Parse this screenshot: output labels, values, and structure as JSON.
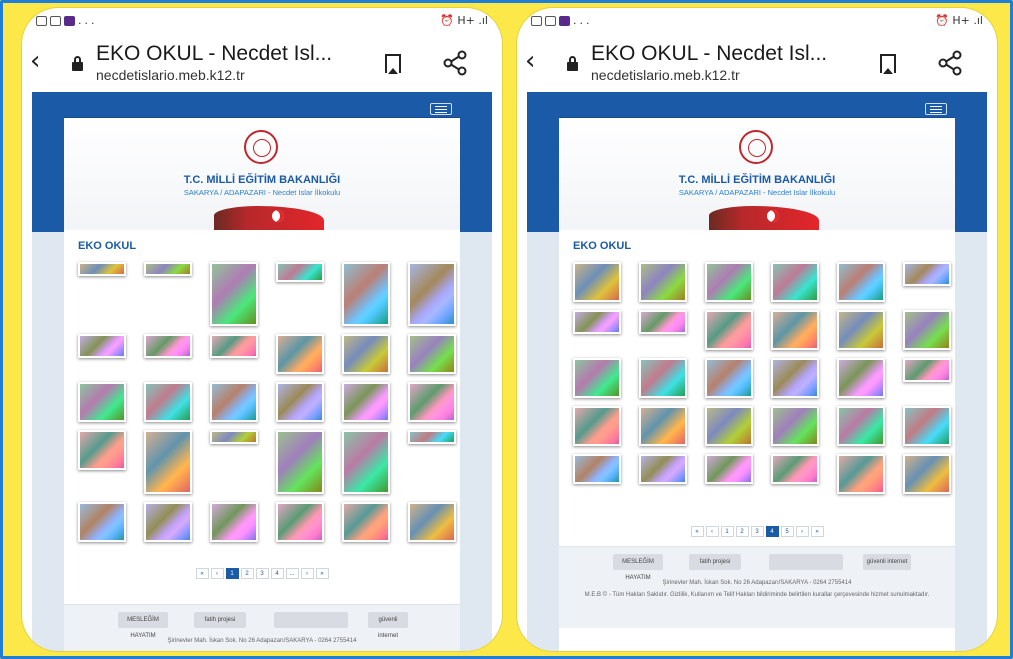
{
  "phones": [
    {
      "status_left": "...",
      "status_right": "⏰ H+ .ıl",
      "title": "EKO OKUL - Necdet Isl...",
      "url": "necdetislario.meb.k12.tr",
      "ministry": "T.C. MİLLİ EĞİTİM BAKANLIĞI",
      "school": "SAKARYA / ADAPAZARI - Necdet Islar İlkokulu",
      "heading": "EKO OKUL",
      "pages": [
        "«",
        "‹",
        "1",
        "2",
        "3",
        "4",
        "...",
        "›",
        "»"
      ],
      "active_page": "1",
      "logos": [
        "MESLEĞİM HAYATIM",
        "fatih projesi",
        "",
        "güvenli internet"
      ],
      "address": "Şirinevler Mah. İskan Sok. No 26 Adapazarı/SAKARYA - 0264 2755414",
      "copyright": ""
    },
    {
      "status_left": "...",
      "status_right": "⏰ H+ .ıl",
      "title": "EKO OKUL - Necdet Isl...",
      "url": "necdetislario.meb.k12.tr",
      "ministry": "T.C. MİLLİ EĞİTİM BAKANLIĞI",
      "school": "SAKARYA / ADAPAZARI - Necdet Islar İlkokulu",
      "heading": "EKO OKUL",
      "pages": [
        "«",
        "‹",
        "1",
        "2",
        "3",
        "4",
        "5",
        "›",
        "»"
      ],
      "active_page": "4",
      "logos": [
        "MESLEĞİM HAYATIM",
        "fatih projesi",
        "",
        "güvenli internet"
      ],
      "address": "Şirinevler Mah. İskan Sok. No 26 Adapazarı/SAKARYA - 0264 2755414",
      "copyright": "M.E.B © - Tüm Hakları Saklıdır. Gizlilik, Kullanım ve Telif Hakları bildiriminde belirtilen kurallar çerçevesinde hizmet sunulmaktadır."
    }
  ]
}
